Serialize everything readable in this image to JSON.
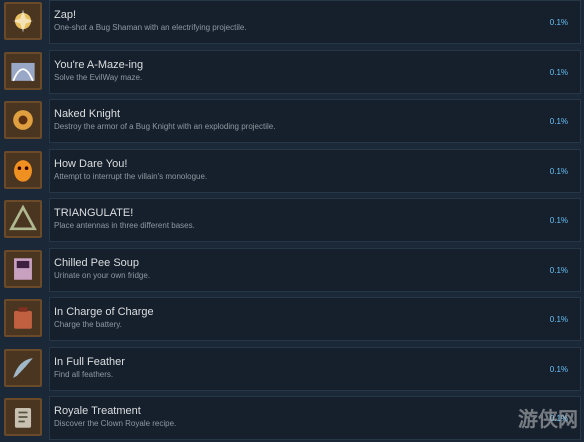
{
  "achievements": [
    {
      "title": "Zap!",
      "description": "One-shot a Bug Shaman with an electrifying projectile.",
      "percent": "0.1%",
      "icon": "zap-achievement-icon",
      "accent": "#e8c060"
    },
    {
      "title": "You're A-Maze-ing",
      "description": "Solve the EvilWay maze.",
      "percent": "0.1%",
      "icon": "maze-achievement-icon",
      "accent": "#9aa8c8"
    },
    {
      "title": "Naked Knight",
      "description": "Destroy the armor of a Bug Knight with an exploding projectile.",
      "percent": "0.1%",
      "icon": "naked-knight-achievement-icon",
      "accent": "#e0a040"
    },
    {
      "title": "How Dare You!",
      "description": "Attempt to interrupt the villain's monologue.",
      "percent": "0.1%",
      "icon": "how-dare-you-achievement-icon",
      "accent": "#f09020"
    },
    {
      "title": "TRIANGULATE!",
      "description": "Place antennas in three different bases.",
      "percent": "0.1%",
      "icon": "triangulate-achievement-icon",
      "accent": "#b0b890"
    },
    {
      "title": "Chilled Pee Soup",
      "description": "Urinate on your own fridge.",
      "percent": "0.1%",
      "icon": "chilled-pee-soup-achievement-icon",
      "accent": "#c8a0c0"
    },
    {
      "title": "In Charge of Charge",
      "description": "Charge the battery.",
      "percent": "0.1%",
      "icon": "battery-achievement-icon",
      "accent": "#c06040"
    },
    {
      "title": "In Full Feather",
      "description": "Find all feathers.",
      "percent": "0.1%",
      "icon": "feather-achievement-icon",
      "accent": "#a0b8c8"
    },
    {
      "title": "Royale Treatment",
      "description": "Discover the Clown Royale recipe.",
      "percent": "0.1%",
      "icon": "royale-treatment-achievement-icon",
      "accent": "#c8c0b0"
    }
  ],
  "watermark": "游侠网"
}
